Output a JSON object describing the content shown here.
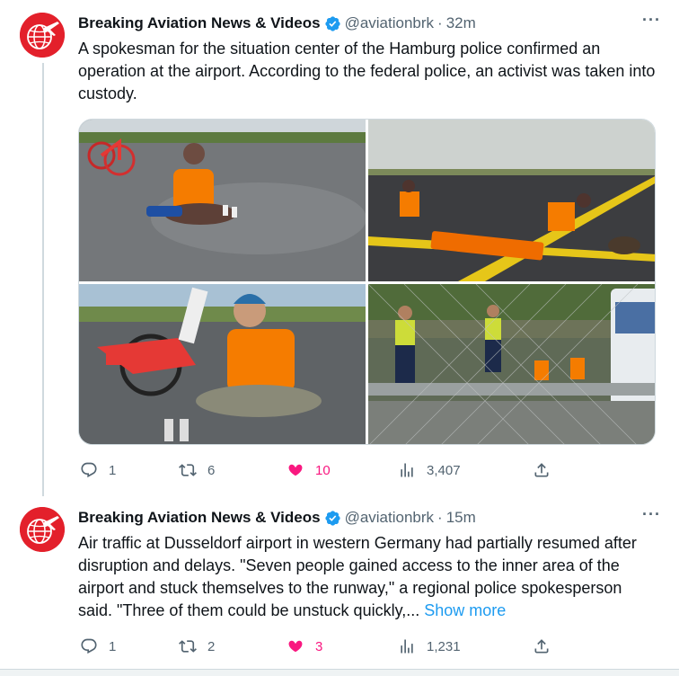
{
  "colors": {
    "accent": "#1d9bf0",
    "like": "#f91880",
    "muted": "#536471",
    "avatar_red": "#e3202b"
  },
  "tweets": [
    {
      "name": "Breaking Aviation News & Videos",
      "handle": "@aviationbrk",
      "separator": "·",
      "time": "32m",
      "text": "A spokesman for the situation center of the Hamburg police confirmed an operation at the airport. According to the federal police, an activist was taken into custody.",
      "show_more": "",
      "media_count": 4,
      "stats": {
        "replies": "1",
        "retweets": "6",
        "likes": "10",
        "views": "3,407"
      },
      "liked": true
    },
    {
      "name": "Breaking Aviation News & Videos",
      "handle": "@aviationbrk",
      "separator": "·",
      "time": "15m",
      "text": "Air traffic at Dusseldorf airport in western Germany had partially resumed after disruption and delays. \"Seven people gained access to the inner area of the airport and stuck themselves to the runway,\" a regional police spokesperson said. \"Three of them could be unstuck quickly,...",
      "show_more": "Show more",
      "stats": {
        "replies": "1",
        "retweets": "2",
        "likes": "3",
        "views": "1,231"
      },
      "liked": true
    }
  ],
  "icons": {
    "avatar": "globe-plane-icon",
    "verified": "verified-badge-icon",
    "more": "more-dots-icon",
    "reply": "reply-icon",
    "retweet": "retweet-icon",
    "like": "heart-icon",
    "views": "views-chart-icon",
    "share": "share-icon"
  }
}
